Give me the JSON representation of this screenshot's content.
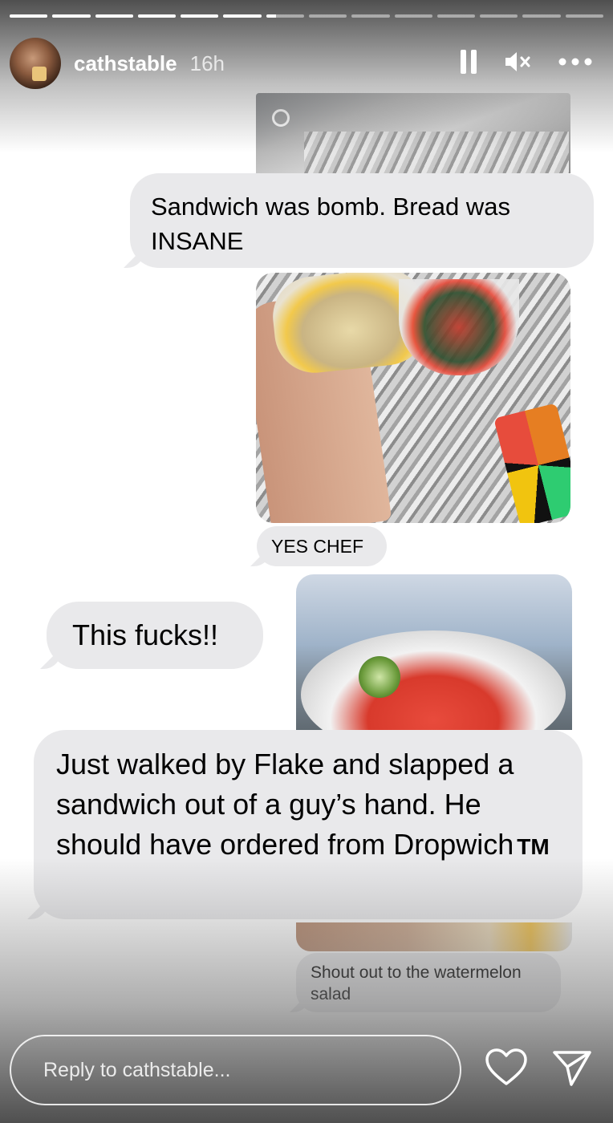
{
  "story": {
    "progress": {
      "segments": 14,
      "active_index": 6,
      "active_fraction": 0.25
    },
    "header": {
      "username": "cathstable",
      "time_ago": "16h",
      "icons": [
        "pause-icon",
        "mute-icon",
        "more-icon"
      ]
    },
    "messages": [
      {
        "id": "m1",
        "text": "Sandwich was bomb. Bread was INSANE"
      },
      {
        "id": "m2",
        "text": "YES CHEF"
      },
      {
        "id": "m3",
        "text": "This fucks!!"
      },
      {
        "id": "m4",
        "text": "Just walked by Flake and slapped a sandwich out of a guy’s hand. He should have ordered from Dropwich",
        "suffix": "TM"
      },
      {
        "id": "m5",
        "text": "Shout out to the watermelon salad"
      }
    ],
    "photos": [
      "foil-wrapped-sandwich-photo",
      "sandwich-and-salad-photo",
      "watermelon-salad-cup-photo",
      "sandwich-edge-photo"
    ],
    "footer": {
      "reply_placeholder": "Reply to cathstable...",
      "icons": [
        "heart-icon",
        "send-icon"
      ]
    }
  }
}
